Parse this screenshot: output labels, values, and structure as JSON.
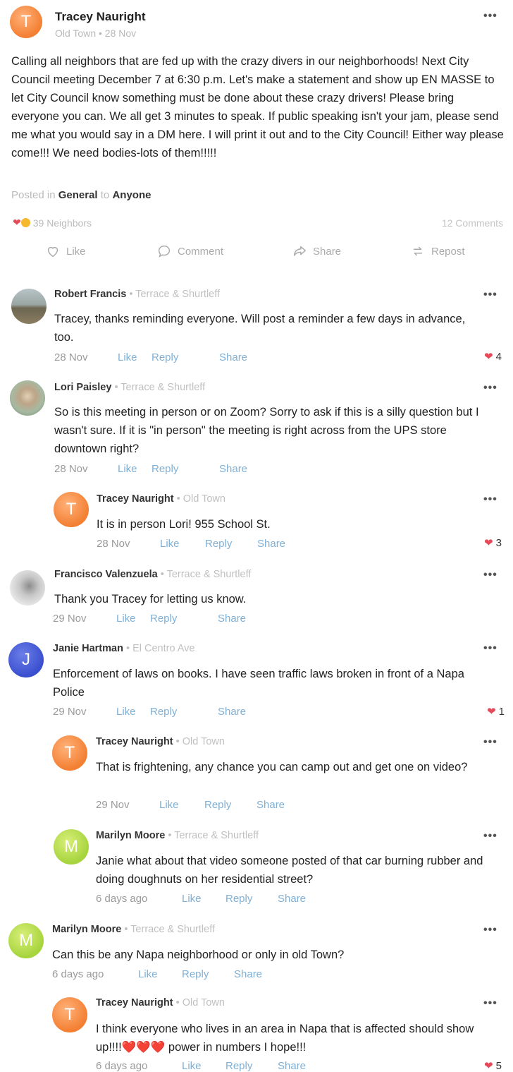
{
  "post": {
    "author": "Tracey Nauright",
    "avatar_letter": "T",
    "location": "Old Town",
    "date": "28 Nov",
    "meta_separator": "•",
    "body": "Calling all neighbors that are fed up with the crazy divers in our neighborhoods! Next City Council meeting December 7 at 6:30 p.m. Let's make a statement and show up EN MASSE to let City Council know something must be done about these crazy drivers! Please bring everyone you can. We all get 3 minutes to speak. If public speaking isn't your jam, please send me what you would say in a DM here. I will print it out and to the City Council! Either way please come!!! We need bodies-lots of them!!!!!",
    "posted_in_prefix": "Posted in",
    "posted_in_category": "General",
    "posted_in_to": "to",
    "posted_in_audience": "Anyone",
    "reactions_count": "39 Neighbors",
    "comments_count": "12 Comments",
    "more_icon": "•••"
  },
  "actions": {
    "like": "Like",
    "comment": "Comment",
    "share": "Share",
    "repost": "Repost"
  },
  "comment_actions": {
    "like": "Like",
    "reply": "Reply",
    "share": "Share"
  },
  "comments": [
    {
      "author": "Robert Francis",
      "location": "Terrace & Shurtleff",
      "text": "Tracey, thanks reminding everyone. Will post a reminder a few days in advance, too.",
      "time": "28 Nov",
      "likes": "4"
    },
    {
      "author": "Lori Paisley",
      "location": "Terrace & Shurtleff",
      "text": "So is this meeting in person or on Zoom?  Sorry to ask if this is a silly question but I wasn't sure.  If it is \"in person\" the meeting is right across from the UPS store downtown right?",
      "time": "28 Nov",
      "likes": ""
    },
    {
      "author": "Tracey Nauright",
      "avatar_letter": "T",
      "location": "Old Town",
      "text": "It is in person Lori! 955 School St.",
      "time": "28 Nov",
      "likes": "3"
    },
    {
      "author": "Francisco Valenzuela",
      "location": "Terrace & Shurtleff",
      "text": "Thank you Tracey for letting us know.",
      "time": "29 Nov",
      "likes": ""
    },
    {
      "author": "Janie Hartman",
      "avatar_letter": "J",
      "location": "El Centro Ave",
      "text": "Enforcement of laws on books.  I have seen traffic laws broken in front of a Napa Police",
      "time": "29 Nov",
      "likes": "1"
    },
    {
      "author": "Tracey Nauright",
      "avatar_letter": "T",
      "location": "Old Town",
      "text": "That is frightening, any chance you can camp out and get one on video?",
      "time": "29 Nov",
      "likes": ""
    },
    {
      "author": "Marilyn Moore",
      "avatar_letter": "M",
      "location": "Terrace & Shurtleff",
      "text": "Janie what about that video someone posted of that car burning rubber and doing doughnuts on her residential street?",
      "time": "6 days ago",
      "likes": ""
    },
    {
      "author": "Marilyn Moore",
      "avatar_letter": "M",
      "location": "Terrace & Shurtleff",
      "text": "Can this be any Napa neighborhood or only in old Town?",
      "time": "6 days ago",
      "likes": ""
    },
    {
      "author": "Tracey Nauright",
      "avatar_letter": "T",
      "location": "Old Town",
      "text": "I think everyone who lives in an area in Napa that is affected should show up!!!!❤️❤️❤️ power in numbers I hope!!!",
      "time": "6 days ago",
      "likes": "5"
    }
  ]
}
